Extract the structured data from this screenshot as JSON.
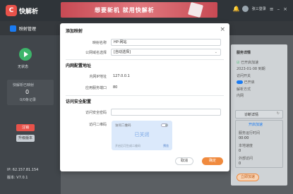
{
  "app": {
    "name": "快解析",
    "logo_letter": "C"
  },
  "banner": {
    "text": "想要新机 就用快解析"
  },
  "titlebar": {
    "account": "张三登录"
  },
  "tabs": [
    {
      "label": "映射管理"
    }
  ],
  "sidebar": {
    "status": "无状态",
    "stat_label": "快解析已映射",
    "stat_value": "0",
    "stat_unit": "0/0条记录",
    "red_button": "注销",
    "gray_button": "升级版本",
    "ip_label": "IP: 62.157.81.154",
    "version": "版本: V7.0.1"
  },
  "dialog": {
    "title": "添加映射",
    "fields": {
      "service_name_label": "映射名称",
      "service_name_value": "HP-网站",
      "public_domain_label": "公网域名选择",
      "public_domain_value": "[自动选择]",
      "intranet_section": "内网配置地址",
      "intranet_ip_label": "内网IP地址",
      "intranet_ip_value": "127.0.0.1",
      "port_label": "应用服务端口",
      "port_value": "80",
      "security_section": "访问安全配置",
      "password_label": "访问安全密码",
      "password_value": "",
      "qr_label": "访问二维码",
      "qr_card_title": "访问二维码",
      "qr_status": "已关闭",
      "qr_hint": "开启后可生成二维码",
      "qr_link": "预览"
    },
    "cancel": "取消",
    "ok": "确定"
  },
  "rightpanel": {
    "title": "服务详情",
    "checkbox": "已开启加速",
    "date": "2023-01-08 到期",
    "label_a": "访问开关",
    "label_b": "已开启",
    "label_c": "解析方式",
    "label_d": "内网",
    "panel_button": "诊断详情",
    "sub_label": "开启加速",
    "stat1_label": "服务运行时间",
    "stat1_value": "00:00",
    "stat2_label": "本地速度",
    "stat2_value": "0",
    "stat3_label": "外部访问",
    "stat3_value": "0",
    "bottom_btn": "立即加速"
  }
}
